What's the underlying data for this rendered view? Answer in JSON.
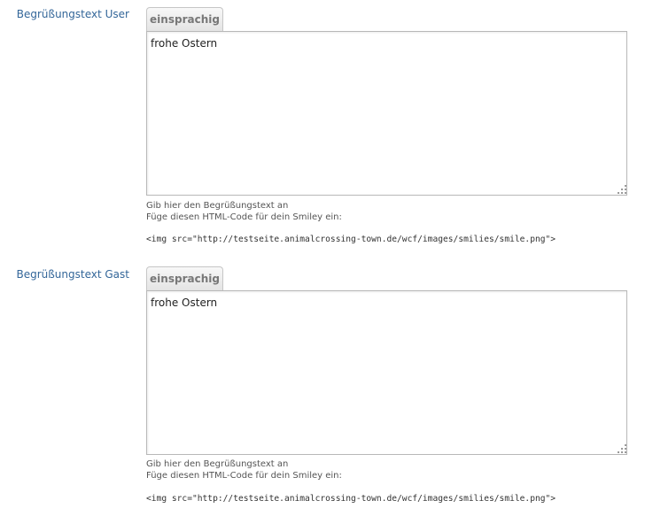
{
  "fields": [
    {
      "label": "Begrüßungstext User",
      "tab_label": "einsprachig",
      "value": "frohe Ostern",
      "help_line_1": "Gib hier den Begrüßungstext an",
      "help_line_2": "Füge diesen HTML-Code für dein Smiley ein:",
      "code": "<img src=\"http://testseite.animalcrossing-town.de/wcf/images/smilies/smile.png\">"
    },
    {
      "label": "Begrüßungstext Gast",
      "tab_label": "einsprachig",
      "value": "frohe Ostern",
      "help_line_1": "Gib hier den Begrüßungstext an",
      "help_line_2": "Füge diesen HTML-Code für dein Smiley ein:",
      "code": "<img src=\"http://testseite.animalcrossing-town.de/wcf/images/smilies/smile.png\">"
    }
  ],
  "colors": {
    "label": "#336699",
    "tab_text": "#777777",
    "border": "#b8b8b8"
  },
  "icons": {
    "resize_handle": "resize-grip-icon"
  }
}
